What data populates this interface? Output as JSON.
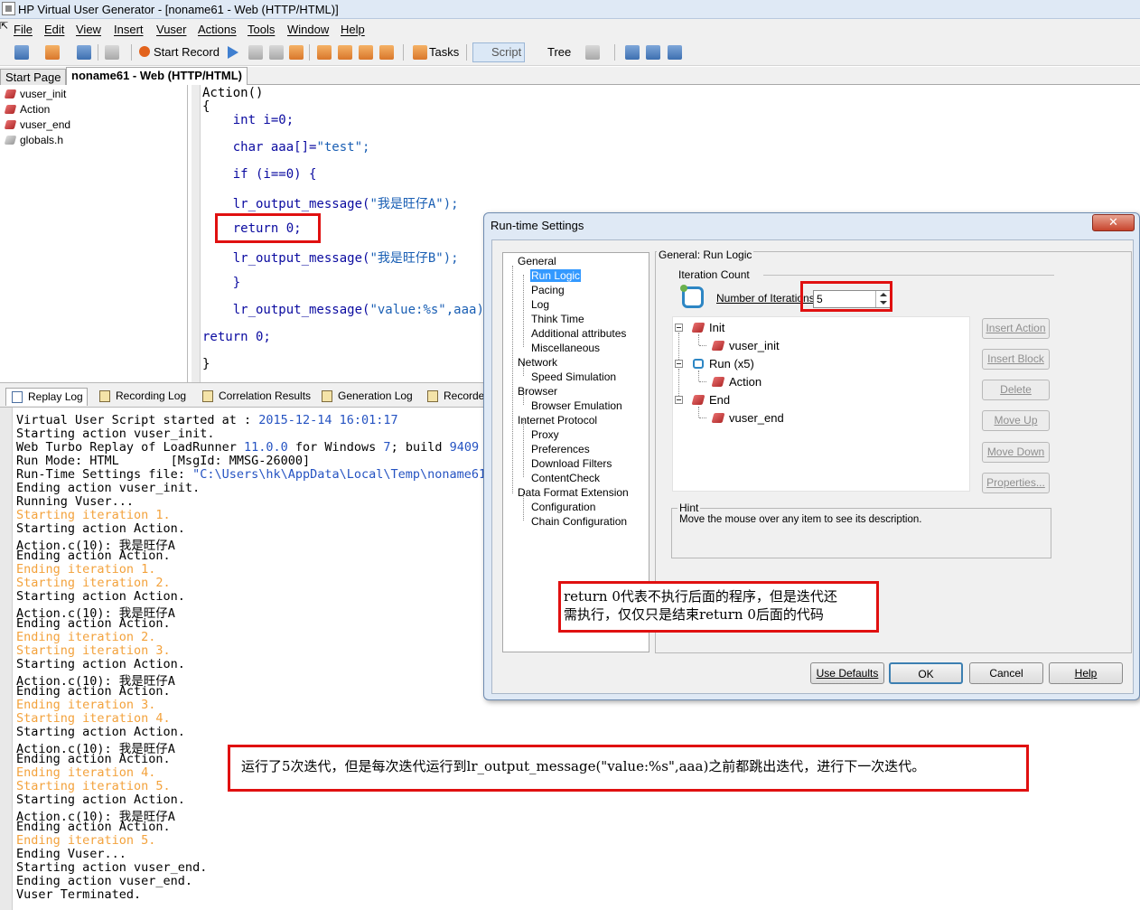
{
  "window": {
    "title": "HP Virtual User Generator - [noname61 - Web (HTTP/HTML)]"
  },
  "menu": [
    "File",
    "Edit",
    "View",
    "Insert",
    "Vuser",
    "Actions",
    "Tools",
    "Window",
    "Help"
  ],
  "toolbar": {
    "start_record": "Start Record",
    "tasks": "Tasks",
    "script": "Script",
    "tree": "Tree"
  },
  "doc_tabs": [
    "Start Page",
    "noname61 - Web (HTTP/HTML)"
  ],
  "left_tree": [
    "vuser_init",
    "Action",
    "vuser_end",
    "globals.h"
  ],
  "code": {
    "l1": "Action()",
    "l2": "{",
    "l3": "    int i=0;",
    "l4a": "    char aaa[]=",
    "l4b": "\"test\";",
    "l5": "    if (i==0) {",
    "l6a": "    lr_output_message(",
    "l6b": "\"我是旺仔A\");",
    "l7": "    return 0;",
    "l8a": "    lr_output_message(",
    "l8b": "\"我是旺仔B\");",
    "l9": "    }",
    "l10a": "    lr_output_message(",
    "l10b": "\"value:%s\",aaa);",
    "l11": "return 0;",
    "l12": "}"
  },
  "bottom_tabs": [
    "Replay Log",
    "Recording Log",
    "Correlation Results",
    "Generation Log",
    "Recorde"
  ],
  "log": {
    "l1a": "Virtual User Script started at : ",
    "l1b": "2015-12-14 16:01:17",
    "l2": "Starting action vuser_init.",
    "l3a": "Web Turbo Replay of LoadRunner ",
    "l3b": "11.0.0",
    "l3c": " for Windows ",
    "l3d": "7",
    "l3e": "; build ",
    "l3f": "9409",
    "l3g": "  (",
    "l4": "Run Mode: HTML       [MsgId: MMSG-26000]",
    "l5a": "Run-Time Settings file: ",
    "l5b": "\"C:\\Users\\hk\\AppData\\Local\\Temp\\noname61\\",
    "l6": "Ending action vuser_init.",
    "l7": "Running Vuser...",
    "l8": "Starting iteration 1.",
    "l9": "Starting action Action.",
    "l10": "Action.c(10): 我是旺仔A",
    "l11": "Ending action Action.",
    "l12": "Ending iteration 1.",
    "l13": "Starting iteration 2.",
    "l14": "Starting action Action.",
    "l15": "Action.c(10): 我是旺仔A",
    "l16": "Ending action Action.",
    "l17": "Ending iteration 2.",
    "l18": "Starting iteration 3.",
    "l19": "Starting action Action.",
    "l20": "Action.c(10): 我是旺仔A",
    "l21": "Ending action Action.",
    "l22": "Ending iteration 3.",
    "l23": "Starting iteration 4.",
    "l24": "Starting action Action.",
    "l25": "Action.c(10): 我是旺仔A",
    "l26": "Ending action Action.",
    "l27": "Ending iteration 4.",
    "l28": "Starting iteration 5.",
    "l29": "Starting action Action.",
    "l30": "Action.c(10): 我是旺仔A",
    "l31": "Ending action Action.",
    "l32": "Ending iteration 5.",
    "l33": "Ending Vuser...",
    "l34": "Starting action vuser_end.",
    "l35": "Ending action vuser_end.",
    "l36": "Vuser Terminated."
  },
  "dialog": {
    "title": "Run-time Settings",
    "close": "✕",
    "tree": {
      "general": "General",
      "run_logic": "Run Logic",
      "pacing": "Pacing",
      "log": "Log",
      "think_time": "Think Time",
      "additional_attributes": "Additional attributes",
      "miscellaneous": "Miscellaneous",
      "network": "Network",
      "speed_simulation": "Speed Simulation",
      "browser": "Browser",
      "browser_emulation": "Browser Emulation",
      "internet_protocol": "Internet Protocol",
      "proxy": "Proxy",
      "preferences": "Preferences",
      "download_filters": "Download Filters",
      "content_check": "ContentCheck",
      "data_format_extension": "Data Format Extension",
      "configuration": "Configuration",
      "chain_configuration": "Chain Configuration"
    },
    "section_title": "General: Run Logic",
    "iteration_count": "Iteration Count",
    "iterations_label": "Number of Iterations:",
    "iterations_value": "5",
    "flow": {
      "init": "Init",
      "vuser_init": "vuser_init",
      "run": "Run (x5)",
      "action": "Action",
      "end": "End",
      "vuser_end": "vuser_end"
    },
    "side_buttons": [
      "Insert Action",
      "Insert Block",
      "Delete",
      "Move Up",
      "Move Down",
      "Properties..."
    ],
    "hint_title": "Hint",
    "hint_text": "Move the mouse over any item to see its description.",
    "buttons": {
      "use_defaults": "Use Defaults",
      "ok": "OK",
      "cancel": "Cancel",
      "help": "Help"
    }
  },
  "annotations": {
    "return_note_1": "return 0代表不执行后面的程序，但是迭代还",
    "return_note_2": "需执行，仅仅只是结束return 0后面的代码",
    "iteration_note": "运行了5次迭代，但是每次迭代运行到lr_output_message(\"value:%s\",aaa)之前都跳出迭代，进行下一次迭代。"
  },
  "colors": {
    "annotation_red": "#e01010",
    "log_iteration_orange": "#f3a23c",
    "selection_blue": "#3399ff"
  }
}
